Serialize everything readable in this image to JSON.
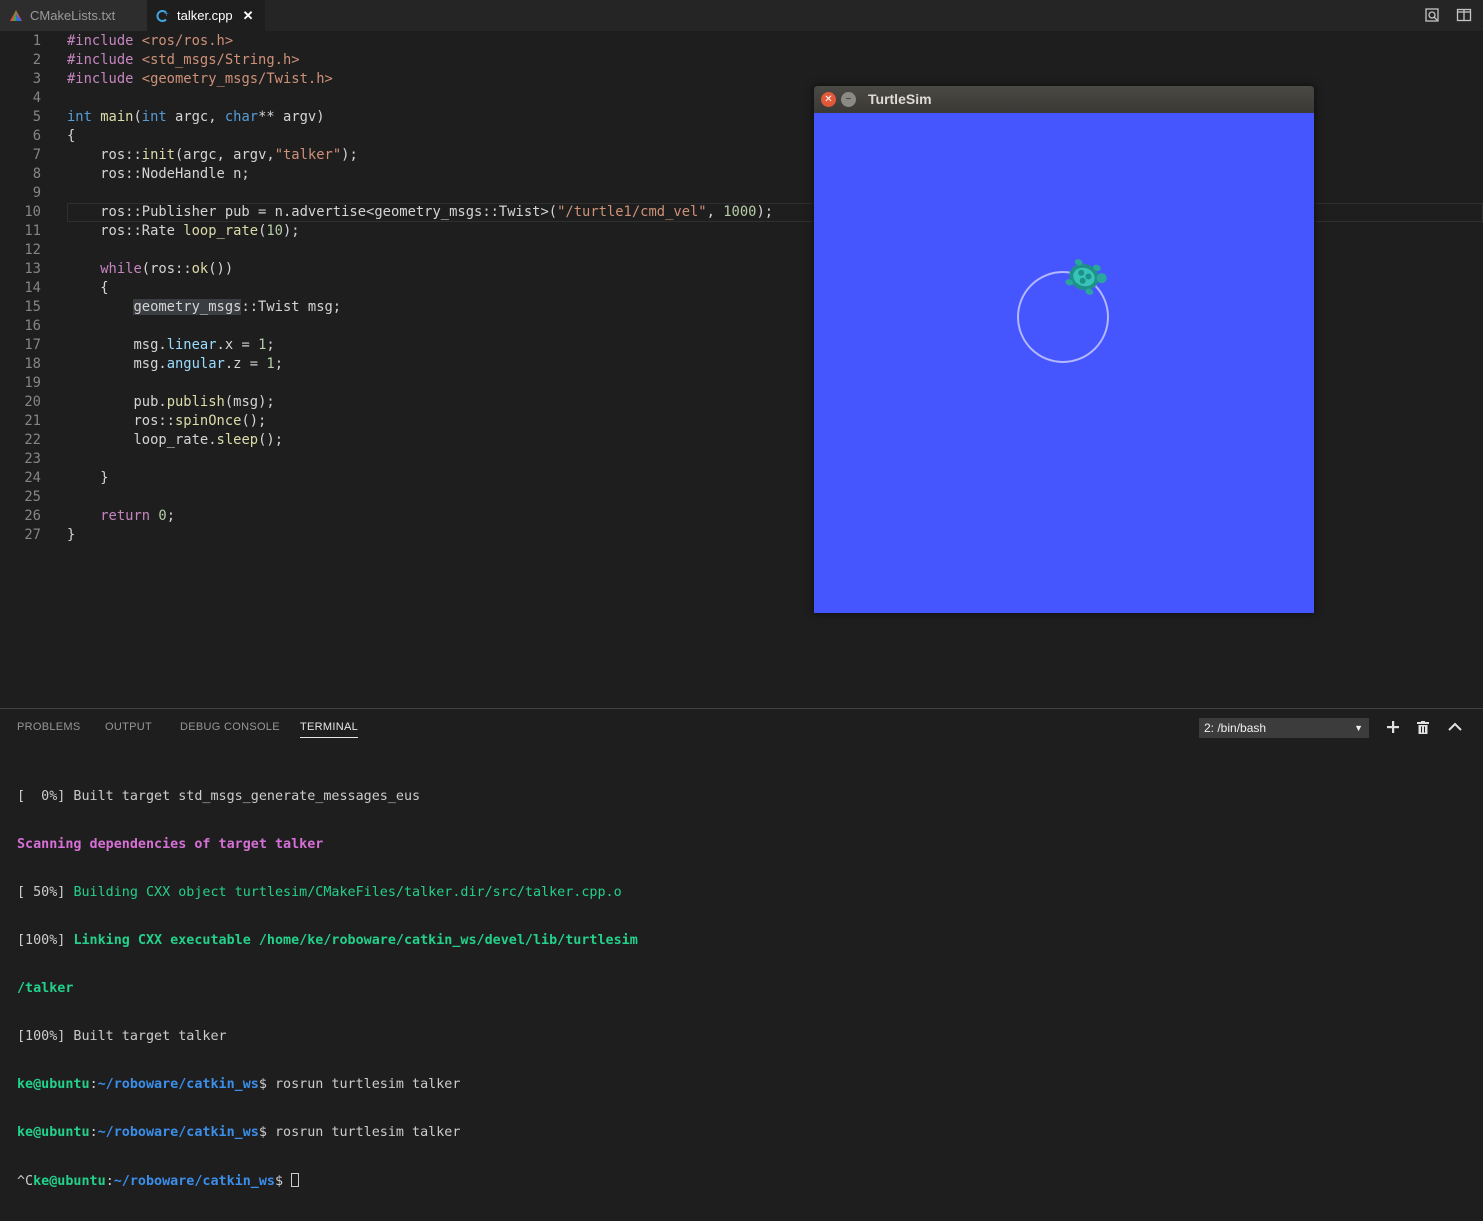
{
  "tabs": [
    {
      "label": "CMakeLists.txt",
      "active": false,
      "icon": "cmake-icon"
    },
    {
      "label": "talker.cpp",
      "active": true,
      "icon": "cpp-file-icon"
    }
  ],
  "tab_actions": [
    "split-compare-icon",
    "split-editor-icon"
  ],
  "editor": {
    "current_line": 10,
    "lines": [
      {
        "n": "1",
        "t": "#include <ros/ros.h>"
      },
      {
        "n": "2",
        "t": "#include <std_msgs/String.h>"
      },
      {
        "n": "3",
        "t": "#include <geometry_msgs/Twist.h>"
      },
      {
        "n": "4",
        "t": ""
      },
      {
        "n": "5",
        "t": "int main(int argc, char** argv)"
      },
      {
        "n": "6",
        "t": "{"
      },
      {
        "n": "7",
        "t": "    ros::init(argc, argv,\"talker\");"
      },
      {
        "n": "8",
        "t": "    ros::NodeHandle n;"
      },
      {
        "n": "9",
        "t": ""
      },
      {
        "n": "10",
        "t": "    ros::Publisher pub = n.advertise<geometry_msgs::Twist>(\"/turtle1/cmd_vel\", 1000);"
      },
      {
        "n": "11",
        "t": "    ros::Rate loop_rate(10);"
      },
      {
        "n": "12",
        "t": ""
      },
      {
        "n": "13",
        "t": "    while(ros::ok())"
      },
      {
        "n": "14",
        "t": "    {"
      },
      {
        "n": "15",
        "t": "        geometry_msgs::Twist msg;"
      },
      {
        "n": "16",
        "t": ""
      },
      {
        "n": "17",
        "t": "        msg.linear.x = 1;"
      },
      {
        "n": "18",
        "t": "        msg.angular.z = 1;"
      },
      {
        "n": "19",
        "t": ""
      },
      {
        "n": "20",
        "t": "        pub.publish(msg);"
      },
      {
        "n": "21",
        "t": "        ros::spinOnce();"
      },
      {
        "n": "22",
        "t": "        loop_rate.sleep();"
      },
      {
        "n": "23",
        "t": ""
      },
      {
        "n": "24",
        "t": "    }"
      },
      {
        "n": "25",
        "t": ""
      },
      {
        "n": "26",
        "t": "    return 0;"
      },
      {
        "n": "27",
        "t": "}"
      }
    ]
  },
  "turtlesim": {
    "title": "TurtleSim",
    "background": "#4556ff",
    "trail_color": "#b3b8ff"
  },
  "panel": {
    "tabs": [
      "PROBLEMS",
      "OUTPUT",
      "DEBUG CONSOLE",
      "TERMINAL"
    ],
    "active_tab": "TERMINAL",
    "terminal_select": "2: /bin/bash",
    "actions": [
      "plus-icon",
      "trash-icon",
      "chevron-up-icon"
    ],
    "terminal": {
      "l1": "[  0%] Built target std_msgs_generate_messages_eus",
      "l2": "Scanning dependencies of target talker",
      "l3_prefix": "[ 50%] ",
      "l3_text": "Building CXX object turtlesim/CMakeFiles/talker.dir/src/talker.cpp.o",
      "l4_prefix": "[100%] ",
      "l4_text": "Linking CXX executable /home/ke/roboware/catkin_ws/devel/lib/turtlesim",
      "l5": "/talker",
      "l6": "[100%] Built target talker",
      "user": "ke@ubuntu",
      "path": "~/roboware/catkin_ws",
      "cmd": "$ rosrun turtlesim talker",
      "ctrl_c": "^C",
      "prompt_end": "$ "
    }
  }
}
